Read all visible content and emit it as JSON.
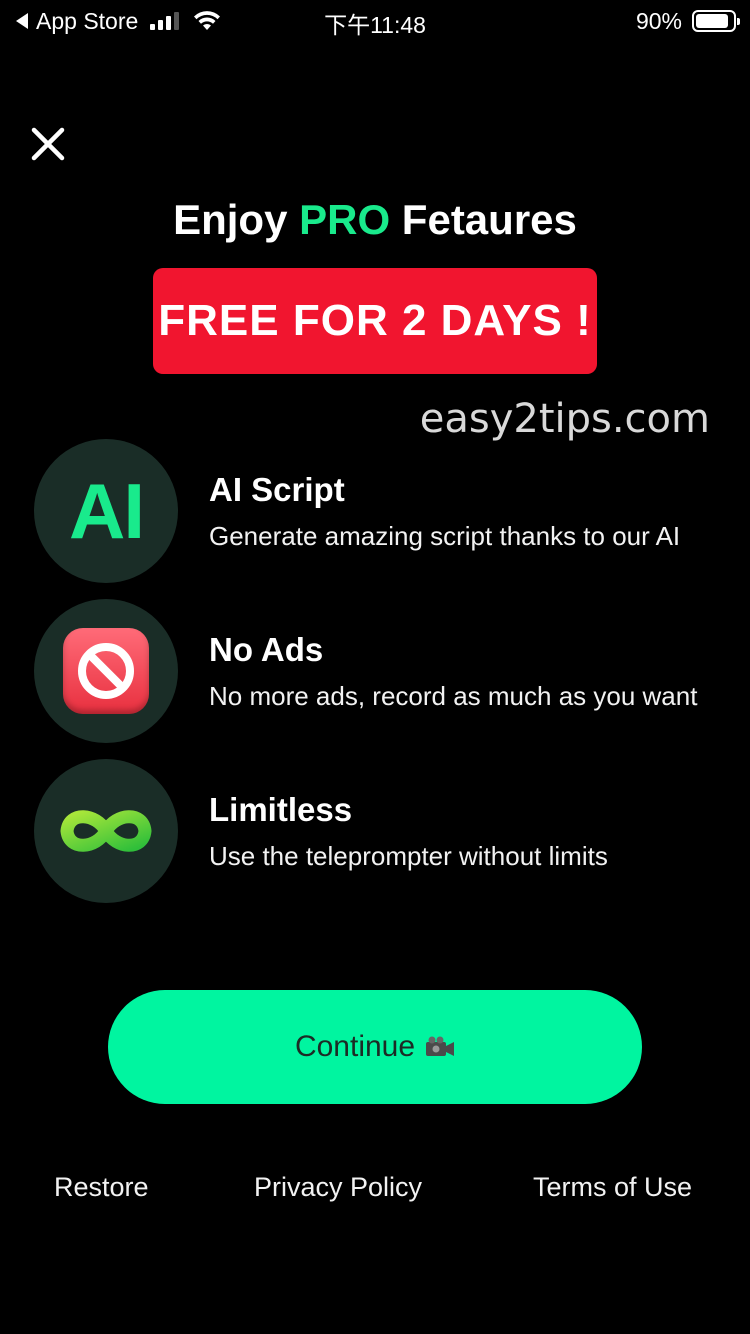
{
  "status_bar": {
    "back_label": "App Store",
    "time": "下午11:48",
    "battery": "90%",
    "battery_level": 0.9
  },
  "header": {
    "title_part1": "Enjoy ",
    "title_highlight": "PRO",
    "title_part2": " Fetaures",
    "highlight_color": "#19ea8c",
    "promo_label": "FREE FOR 2 DAYS !",
    "promo_color": "#f1152f"
  },
  "watermark": "easy2tips.com",
  "features": [
    {
      "icon": "ai-icon",
      "icon_text": "AI",
      "title": "AI Script",
      "description": "Generate amazing script thanks to our AI"
    },
    {
      "icon": "no-entry-icon",
      "title": "No Ads",
      "description": "No more ads, record as much as you want"
    },
    {
      "icon": "infinity-icon",
      "title": "Limitless",
      "description": "Use the teleprompter without limits"
    }
  ],
  "cta": {
    "label": "Continue",
    "icon": "video-camera-icon",
    "color": "#00f5a0"
  },
  "footer": {
    "restore": "Restore",
    "privacy": "Privacy Policy",
    "terms": "Terms of Use"
  }
}
